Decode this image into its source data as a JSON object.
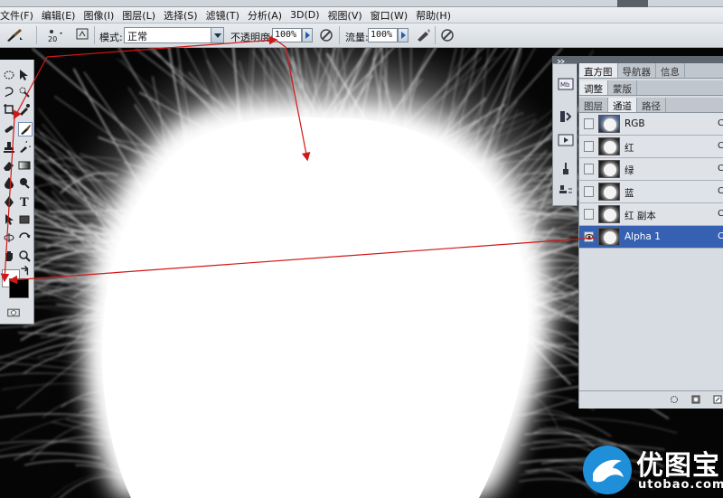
{
  "menubar": {
    "items": [
      "文件(F)",
      "编辑(E)",
      "图像(I)",
      "图层(L)",
      "选择(S)",
      "滤镜(T)",
      "分析(A)",
      "3D(D)",
      "视图(V)",
      "窗口(W)",
      "帮助(H)"
    ]
  },
  "options": {
    "brush_size": "20",
    "mode_label": "模式:",
    "mode_value": "正常",
    "opacity_label": "不透明度:",
    "opacity_value": "100%",
    "flow_label": "流量:",
    "flow_value": "100%"
  },
  "panels": {
    "tabs_top": [
      "直方图",
      "导航器",
      "信息"
    ],
    "tabs_mid": [
      "调整",
      "蒙版"
    ],
    "tabs_channels": [
      "图层",
      "通道",
      "路径"
    ],
    "channels": [
      {
        "name": "RGB",
        "shortcut": "C",
        "thumb": "color"
      },
      {
        "name": "红",
        "shortcut": "C",
        "thumb": "gray"
      },
      {
        "name": "绿",
        "shortcut": "C",
        "thumb": "gray"
      },
      {
        "name": "蓝",
        "shortcut": "C",
        "thumb": "gray"
      },
      {
        "name": "红 副本",
        "shortcut": "C",
        "thumb": "gray"
      },
      {
        "name": "Alpha 1",
        "shortcut": "C",
        "thumb": "gray",
        "selected": true,
        "visible": true
      }
    ]
  },
  "watermark": {
    "title": "优图宝",
    "subtitle": "utobao.com"
  },
  "colors": {
    "selection": "#3661b3",
    "annotation_arrow": "#d01818",
    "watermark_blue": "#1e8fd8"
  }
}
